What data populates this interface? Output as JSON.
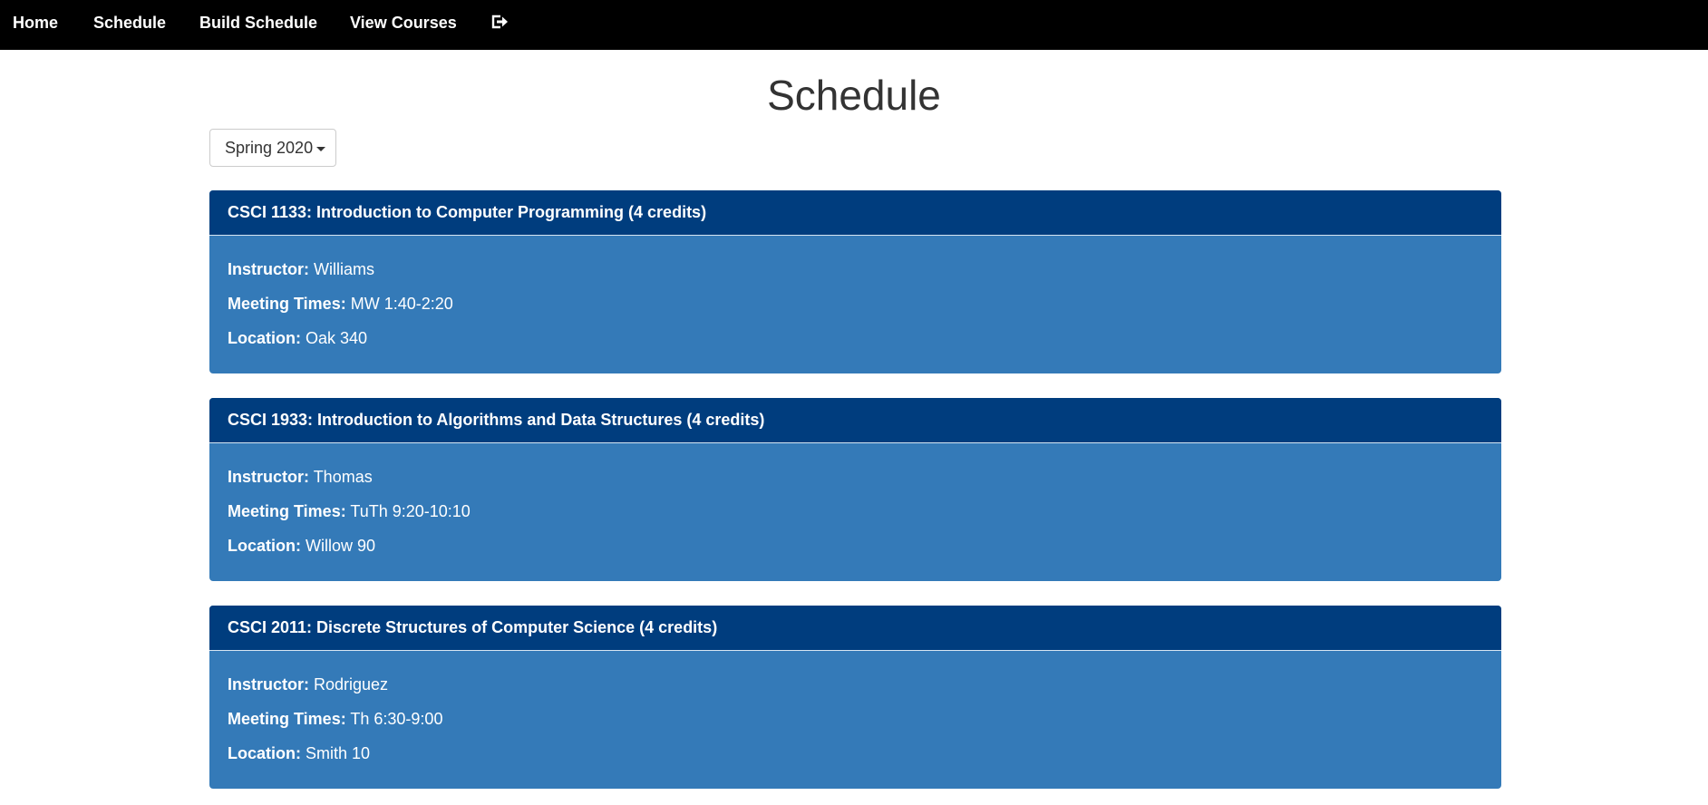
{
  "nav": {
    "items": [
      {
        "label": "Home"
      },
      {
        "label": "Schedule"
      },
      {
        "label": "Build Schedule"
      },
      {
        "label": "View Courses"
      }
    ],
    "logout_icon": "logout-icon"
  },
  "page": {
    "title": "Schedule"
  },
  "term_select": {
    "selected": "Spring 2020"
  },
  "labels": {
    "instructor": "Instructor:",
    "meeting_times": "Meeting Times:",
    "location": "Location:"
  },
  "courses": [
    {
      "title": "CSCI 1133: Introduction to Computer Programming (4 credits)",
      "instructor": "Williams",
      "meeting_times": "MW 1:40-2:20",
      "location": "Oak 340"
    },
    {
      "title": "CSCI 1933: Introduction to Algorithms and Data Structures (4 credits)",
      "instructor": "Thomas",
      "meeting_times": "TuTh 9:20-10:10",
      "location": "Willow 90"
    },
    {
      "title": "CSCI 2011: Discrete Structures of Computer Science (4 credits)",
      "instructor": "Rodriguez",
      "meeting_times": "Th 6:30-9:00",
      "location": "Smith 10"
    }
  ],
  "colors": {
    "navbar_bg": "#000000",
    "panel_heading_bg": "#003d7e",
    "panel_body_bg": "#347ab8"
  }
}
